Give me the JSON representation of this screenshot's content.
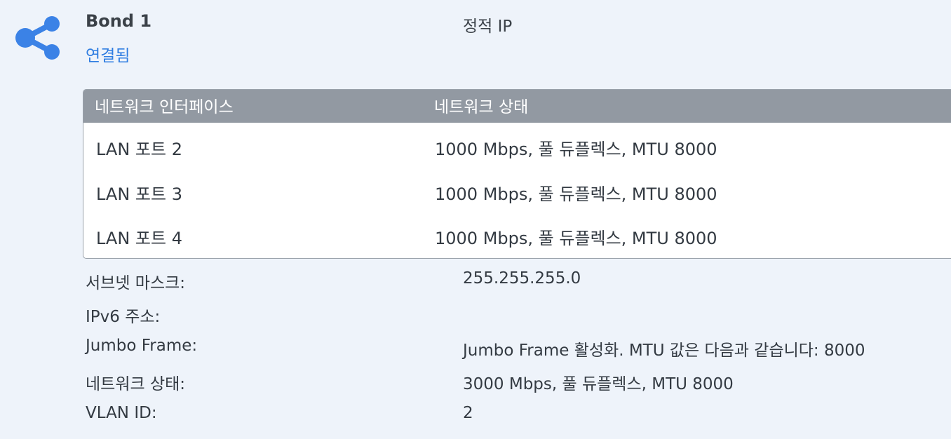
{
  "interface": {
    "icon": "share-network-icon",
    "name": "Bond 1",
    "status": "연결됨",
    "ip_mode": "정적 IP",
    "accent_color": "#2f7de1"
  },
  "port_table": {
    "columns": [
      "네트워크 인터페이스",
      "네트워크 상태"
    ],
    "rows": [
      {
        "port": "LAN 포트 2",
        "state": "1000 Mbps, 풀 듀플렉스, MTU 8000"
      },
      {
        "port": "LAN 포트 3",
        "state": "1000 Mbps, 풀 듀플렉스, MTU 8000"
      },
      {
        "port": "LAN 포트 4",
        "state": "1000 Mbps, 풀 듀플렉스, MTU 8000"
      }
    ]
  },
  "details": [
    {
      "label": "서브넷 마스크:",
      "value": "255.255.255.0"
    },
    {
      "label": "IPv6 주소:",
      "value": ""
    },
    {
      "label": "Jumbo Frame:",
      "value": "Jumbo Frame 활성화. MTU 값은 다음과 같습니다: 8000"
    },
    {
      "label": "네트워크 상태:",
      "value": "3000 Mbps, 풀 듀플렉스, MTU 8000"
    },
    {
      "label": "VLAN ID:",
      "value": "2"
    }
  ]
}
